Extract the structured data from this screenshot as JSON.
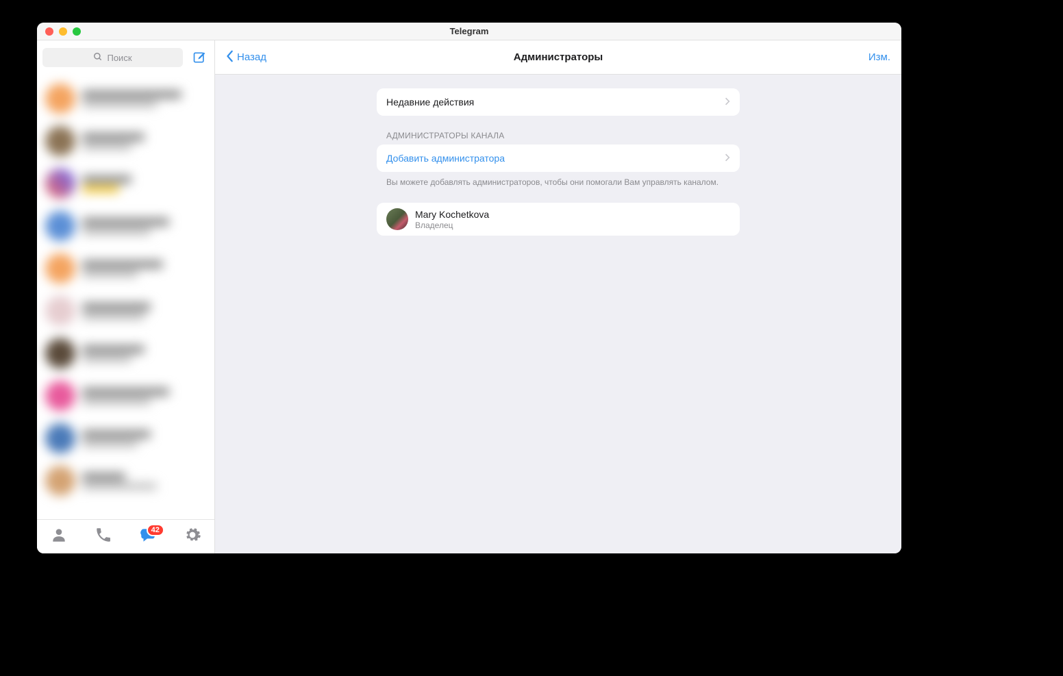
{
  "window": {
    "title": "Telegram"
  },
  "sidebar": {
    "search": {
      "placeholder": "Поиск"
    },
    "tabs": {
      "chats_badge": "42"
    }
  },
  "header": {
    "back": "Назад",
    "title": "Администраторы",
    "edit": "Изм."
  },
  "main": {
    "recent_actions": "Недавние действия",
    "section_title": "АДМИНИСТРАТОРЫ КАНАЛА",
    "add_admin": "Добавить администратора",
    "footer": "Вы можете добавлять администраторов, чтобы они помогали Вам управлять каналом.",
    "admins": [
      {
        "name": "Mary Kochetkova",
        "role": "Владелец"
      }
    ]
  }
}
